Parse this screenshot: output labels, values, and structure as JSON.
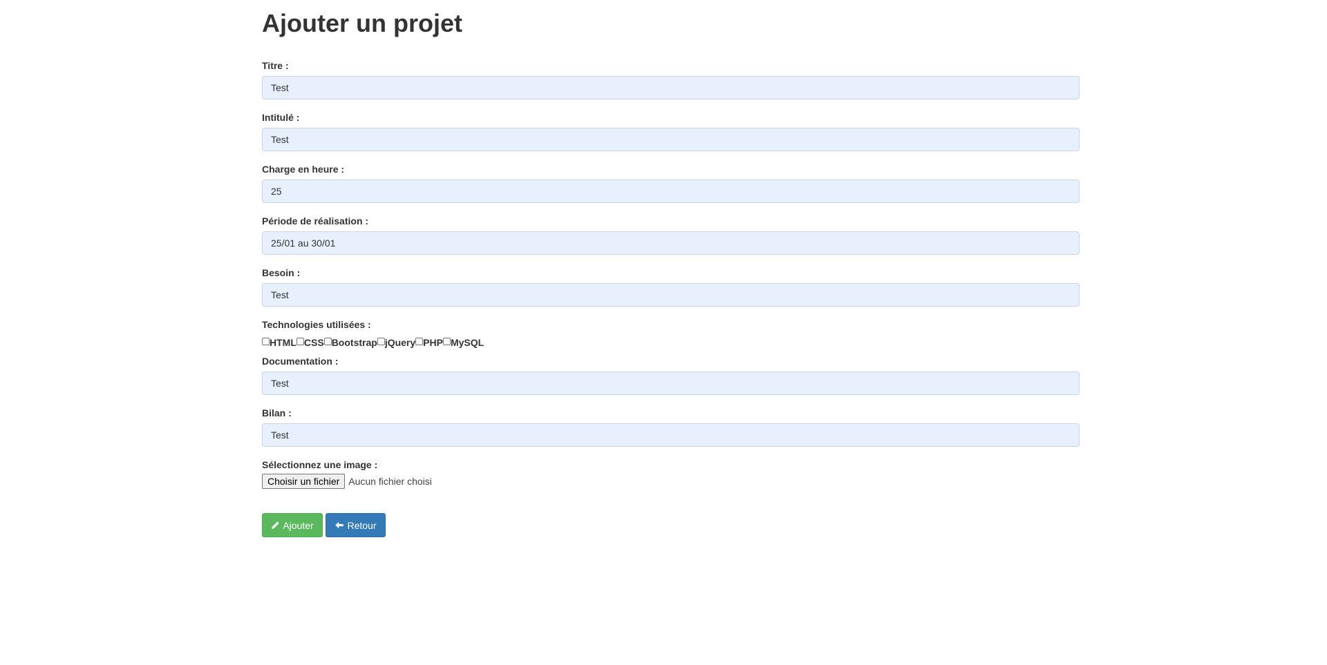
{
  "page": {
    "title": "Ajouter un projet"
  },
  "form": {
    "titre": {
      "label": "Titre :",
      "value": "Test"
    },
    "intitule": {
      "label": "Intitulé :",
      "value": "Test"
    },
    "charge": {
      "label": "Charge en heure :",
      "value": "25"
    },
    "periode": {
      "label": "Période de réalisation :",
      "value": "25/01 au 30/01"
    },
    "besoin": {
      "label": "Besoin :",
      "value": "Test"
    },
    "technologies": {
      "label": "Technologies utilisées :",
      "options": [
        "HTML",
        "CSS",
        "Bootstrap",
        "jQuery",
        "PHP",
        "MySQL"
      ]
    },
    "documentation": {
      "label": "Documentation :",
      "value": "Test"
    },
    "bilan": {
      "label": "Bilan :",
      "value": "Test"
    },
    "image": {
      "label": "Sélectionnez une image :",
      "button_label": "Choisir un fichier",
      "status": "Aucun fichier choisi"
    }
  },
  "actions": {
    "add_label": "Ajouter",
    "back_label": "Retour"
  },
  "colors": {
    "success": "#5cb85c",
    "primary": "#337ab7",
    "input_bg": "#e8f0fe"
  },
  "icons": {
    "add": "pencil-icon",
    "back": "arrow-left-icon"
  }
}
